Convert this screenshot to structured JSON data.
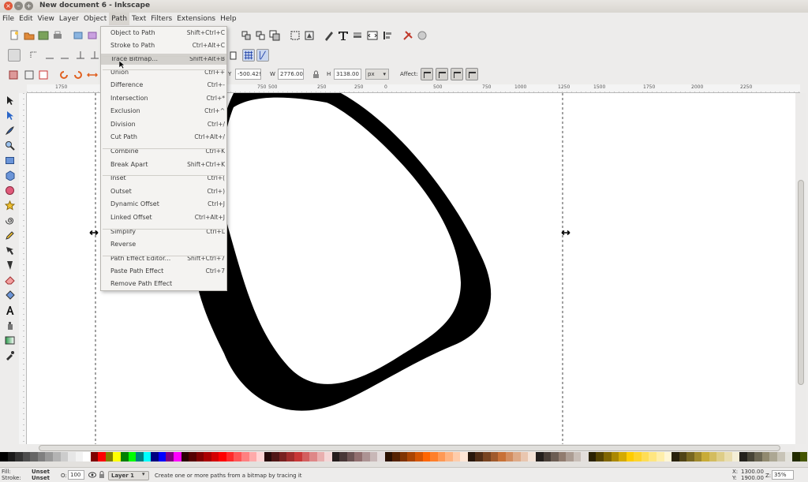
{
  "window": {
    "title": "New document 6 - Inkscape"
  },
  "menubar": [
    "File",
    "Edit",
    "View",
    "Layer",
    "Object",
    "Path",
    "Text",
    "Filters",
    "Extensions",
    "Help"
  ],
  "path_menu": [
    {
      "label": "Object to Path",
      "shortcut": "Shift+Ctrl+C"
    },
    {
      "label": "Stroke to Path",
      "shortcut": "Ctrl+Alt+C"
    },
    {
      "label": "Trace Bitmap...",
      "shortcut": "Shift+Alt+B"
    },
    {
      "label": "Union",
      "shortcut": "Ctrl++"
    },
    {
      "label": "Difference",
      "shortcut": "Ctrl+-"
    },
    {
      "label": "Intersection",
      "shortcut": "Ctrl+*"
    },
    {
      "label": "Exclusion",
      "shortcut": "Ctrl+^"
    },
    {
      "label": "Division",
      "shortcut": "Ctrl+/"
    },
    {
      "label": "Cut Path",
      "shortcut": "Ctrl+Alt+/"
    },
    {
      "label": "Combine",
      "shortcut": "Ctrl+K"
    },
    {
      "label": "Break Apart",
      "shortcut": "Shift+Ctrl+K"
    },
    {
      "label": "Inset",
      "shortcut": "Ctrl+("
    },
    {
      "label": "Outset",
      "shortcut": "Ctrl+)"
    },
    {
      "label": "Dynamic Offset",
      "shortcut": "Ctrl+J"
    },
    {
      "label": "Linked Offset",
      "shortcut": "Ctrl+Alt+J"
    },
    {
      "label": "Simplify",
      "shortcut": "Ctrl+L"
    },
    {
      "label": "Reverse",
      "shortcut": ""
    },
    {
      "label": "Path Effect Editor...",
      "shortcut": "Shift+Ctrl+7"
    },
    {
      "label": "Paste Path Effect",
      "shortcut": "Ctrl+7"
    },
    {
      "label": "Remove Path Effect",
      "shortcut": ""
    }
  ],
  "selector_toolbar": {
    "y_label": "Y",
    "y_value": "-500.42!",
    "w_label": "W",
    "w_value": "2776.00",
    "h_label": "H",
    "h_value": "3138.00",
    "unit": "px",
    "affect_label": "Affect:"
  },
  "ruler": {
    "labels": [
      "1750",
      "1500",
      "1250",
      "1000",
      "750",
      "500",
      "250",
      "0",
      "250",
      "500",
      "750",
      "1000",
      "1250",
      "1500",
      "1750",
      "2000",
      "2250"
    ]
  },
  "status": {
    "fill_label": "Fill:",
    "fill_value": "Unset",
    "stroke_label": "Stroke:",
    "stroke_value": "Unset",
    "opacity_label": "O:",
    "opacity_value": "100",
    "layer": "Layer 1",
    "message": "Create one or more paths from a bitmap by tracing it",
    "x_label": "X:",
    "x_value": "1300.00",
    "y_label": "Y:",
    "y_value": "1900.00",
    "zoom_label": "Z:",
    "zoom_value": "35%"
  },
  "colors": {
    "menu_highlight": "#d3d1cd",
    "palette": [
      "#000000",
      "#1a1a1a",
      "#333333",
      "#4d4d4d",
      "#666666",
      "#808080",
      "#999999",
      "#b3b3b3",
      "#cccccc",
      "#e6e6e6",
      "#f2f2f2",
      "#ffffff",
      "#800000",
      "#ff0000",
      "#808000",
      "#ffff00",
      "#008000",
      "#00ff00",
      "#008080",
      "#00ffff",
      "#000080",
      "#0000ff",
      "#800080",
      "#ff00ff",
      "#2b0000",
      "#550000",
      "#800000",
      "#aa0000",
      "#d40000",
      "#ff0000",
      "#ff2a2a",
      "#ff5555",
      "#ff8080",
      "#ffaaaa",
      "#ffd5d5",
      "#280b0b",
      "#501616",
      "#782121",
      "#a02c2c",
      "#c83737",
      "#d35f5f",
      "#de8787",
      "#e9afaf",
      "#f4d7d7",
      "#241c1c",
      "#483737",
      "#6c5353",
      "#916f6f",
      "#ac9393",
      "#c8b7b7",
      "#e3dbdb",
      "#2b1100",
      "#552200",
      "#803300",
      "#aa4400",
      "#d45500",
      "#ff6600",
      "#ff7f2a",
      "#ff9955",
      "#ffb380",
      "#ffccaa",
      "#ffe6d5",
      "#28170b",
      "#502d16",
      "#784421",
      "#a05a2c",
      "#c87137",
      "#d38d5f",
      "#deaa87",
      "#e9c6af",
      "#f4e3d7",
      "#241f1c",
      "#483e37",
      "#6c5d53",
      "#917c6f",
      "#ac9d93",
      "#c8beb7",
      "#e3dedb",
      "#2b2200",
      "#554400",
      "#806600",
      "#aa8800",
      "#d4aa00",
      "#ffcc00",
      "#ffd42a",
      "#ffdd55",
      "#ffe680",
      "#ffeeaa",
      "#fff6d5",
      "#28220b",
      "#504416",
      "#786721",
      "#a0892c",
      "#c8ab37",
      "#d3bc5f",
      "#decd87",
      "#e9ddaf",
      "#f4eed7",
      "#24221c",
      "#484537",
      "#6c6753",
      "#918a6f",
      "#aca793",
      "#c8c4b7",
      "#e3e2db",
      "#222b00",
      "#445500"
    ]
  }
}
